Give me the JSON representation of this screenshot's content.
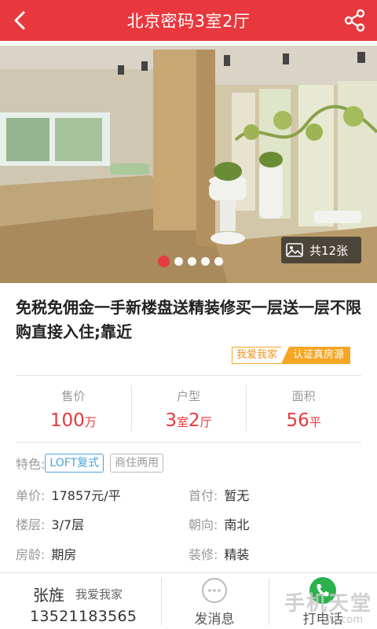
{
  "header": {
    "title": "北京密码3室2厅",
    "back_icon": "chevron-left-icon",
    "share_icon": "share-icon",
    "color": "#e8383d"
  },
  "gallery": {
    "count_label": "共12张",
    "dots_total": 5,
    "active_index": 0
  },
  "listing": {
    "title": "免税免佣金一手新楼盘送精装修买一层送一层不限购直接入住;靠近",
    "tag_love": "我爱我家",
    "tag_verified": "认证真房源"
  },
  "stats": [
    {
      "label": "售价",
      "value": "100",
      "unit": "万"
    },
    {
      "label": "户型",
      "value_parts": [
        "3",
        "室",
        "2",
        "厅"
      ]
    },
    {
      "label": "面积",
      "value": "56",
      "unit": "平"
    }
  ],
  "features": {
    "label": "特色:",
    "chips": [
      "LOFT复式",
      "商住两用"
    ]
  },
  "details": {
    "unit_price": {
      "label": "单价:",
      "value": "17857元/平"
    },
    "down_payment": {
      "label": "首付:",
      "value": "暂无"
    },
    "floor": {
      "label": "楼层:",
      "value": "3/7层"
    },
    "orientation": {
      "label": "朝向:",
      "value": "南北"
    },
    "age": {
      "label": "房龄:",
      "value": "期房"
    },
    "decoration": {
      "label": "装修:",
      "value": "精装"
    }
  },
  "agent": {
    "name": "张旌",
    "company": "我爱我家",
    "phone": "13521183565"
  },
  "actions": {
    "message_label": "发消息",
    "call_label": "打电话"
  },
  "watermark": {
    "main": "手机天堂",
    "sub": "sjtt.com"
  }
}
